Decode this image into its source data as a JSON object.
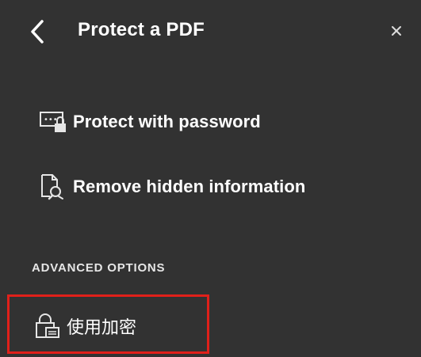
{
  "header": {
    "title": "Protect a PDF",
    "back_icon": "chevron-left-icon",
    "close_label": "×"
  },
  "items": [
    {
      "label": "Protect with password",
      "icon": "password-lock-icon"
    },
    {
      "label": "Remove hidden information",
      "icon": "document-search-icon"
    }
  ],
  "advanced": {
    "section_label": "ADVANCED OPTIONS",
    "encrypt_label": "使用加密",
    "encrypt_icon": "encryption-lock-icon",
    "highlight_color": "#e0201a"
  },
  "colors": {
    "background": "#323232",
    "text": "#ffffff"
  }
}
